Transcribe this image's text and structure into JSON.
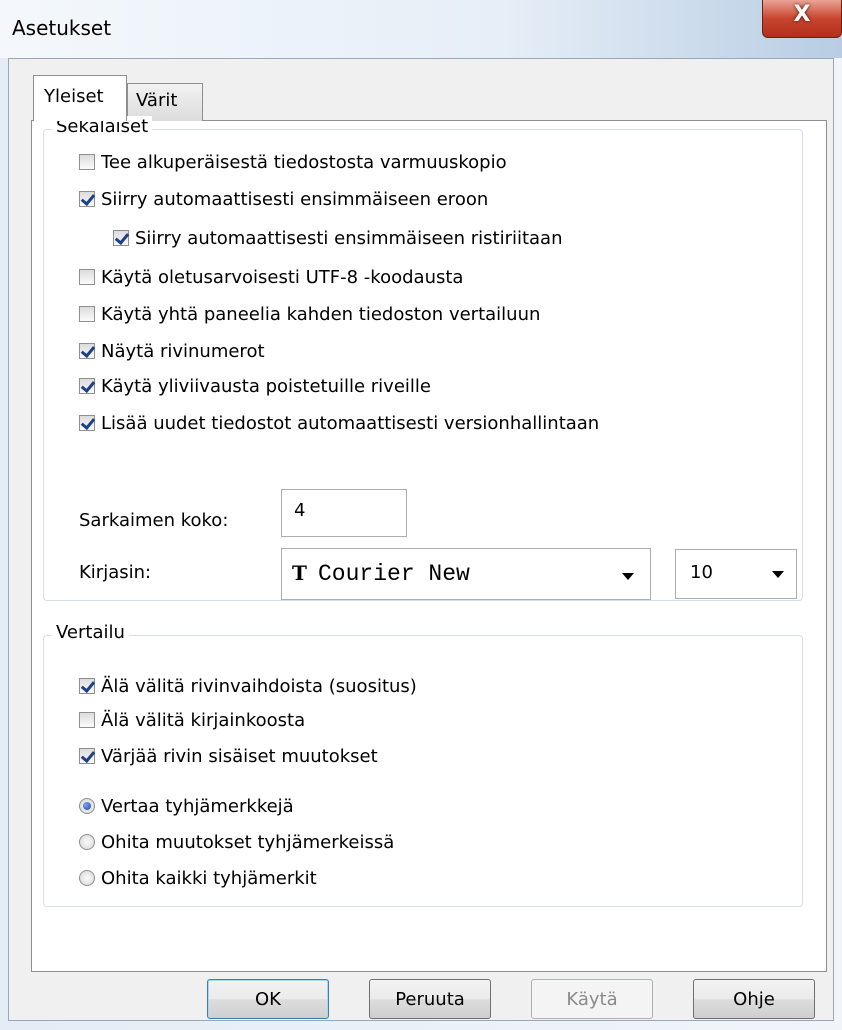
{
  "window": {
    "title": "Asetukset",
    "close_glyph": "X"
  },
  "tabs": [
    {
      "label": "Yleiset",
      "selected": true
    },
    {
      "label": "Värit",
      "selected": false
    }
  ],
  "misc_group": {
    "title": "Sekalaiset",
    "checkboxes": [
      {
        "label": "Tee alkuperäisestä tiedostosta varmuuskopio",
        "checked": false
      },
      {
        "label": "Siirry automaattisesti ensimmäiseen eroon",
        "checked": true
      },
      {
        "label": "Siirry automaattisesti ensimmäiseen ristiriitaan",
        "checked": true
      },
      {
        "label": "Käytä oletusarvoisesti UTF-8 -koodausta",
        "checked": false
      },
      {
        "label": "Käytä yhtä paneelia kahden tiedoston vertailuun",
        "checked": false
      },
      {
        "label": "Näytä rivinumerot",
        "checked": true
      },
      {
        "label": "Käytä yliviivausta poistetuille riveille",
        "checked": true
      },
      {
        "label": "Lisää uudet tiedostot automaattisesti versionhallintaan",
        "checked": true
      }
    ],
    "tab_size_label": "Sarkaimen koko:",
    "tab_size_value": "4",
    "font_label": "Kirjasin:",
    "font_icon": "T",
    "font_name": "Courier New",
    "font_size": "10"
  },
  "compare_group": {
    "title": "Vertailu",
    "checkboxes": [
      {
        "label": "Älä välitä rivinvaihdoista (suositus)",
        "checked": true
      },
      {
        "label": "Älä välitä kirjainkoosta",
        "checked": false
      },
      {
        "label": "Värjää rivin sisäiset muutokset",
        "checked": true
      }
    ],
    "radios": [
      {
        "label": "Vertaa tyhjämerkkejä",
        "selected": true
      },
      {
        "label": "Ohita muutokset tyhjämerkeissä",
        "selected": false
      },
      {
        "label": "Ohita kaikki tyhjämerkit",
        "selected": false
      }
    ]
  },
  "buttons": {
    "ok": "OK",
    "cancel": "Peruuta",
    "apply": "Käytä",
    "help": "Ohje"
  }
}
